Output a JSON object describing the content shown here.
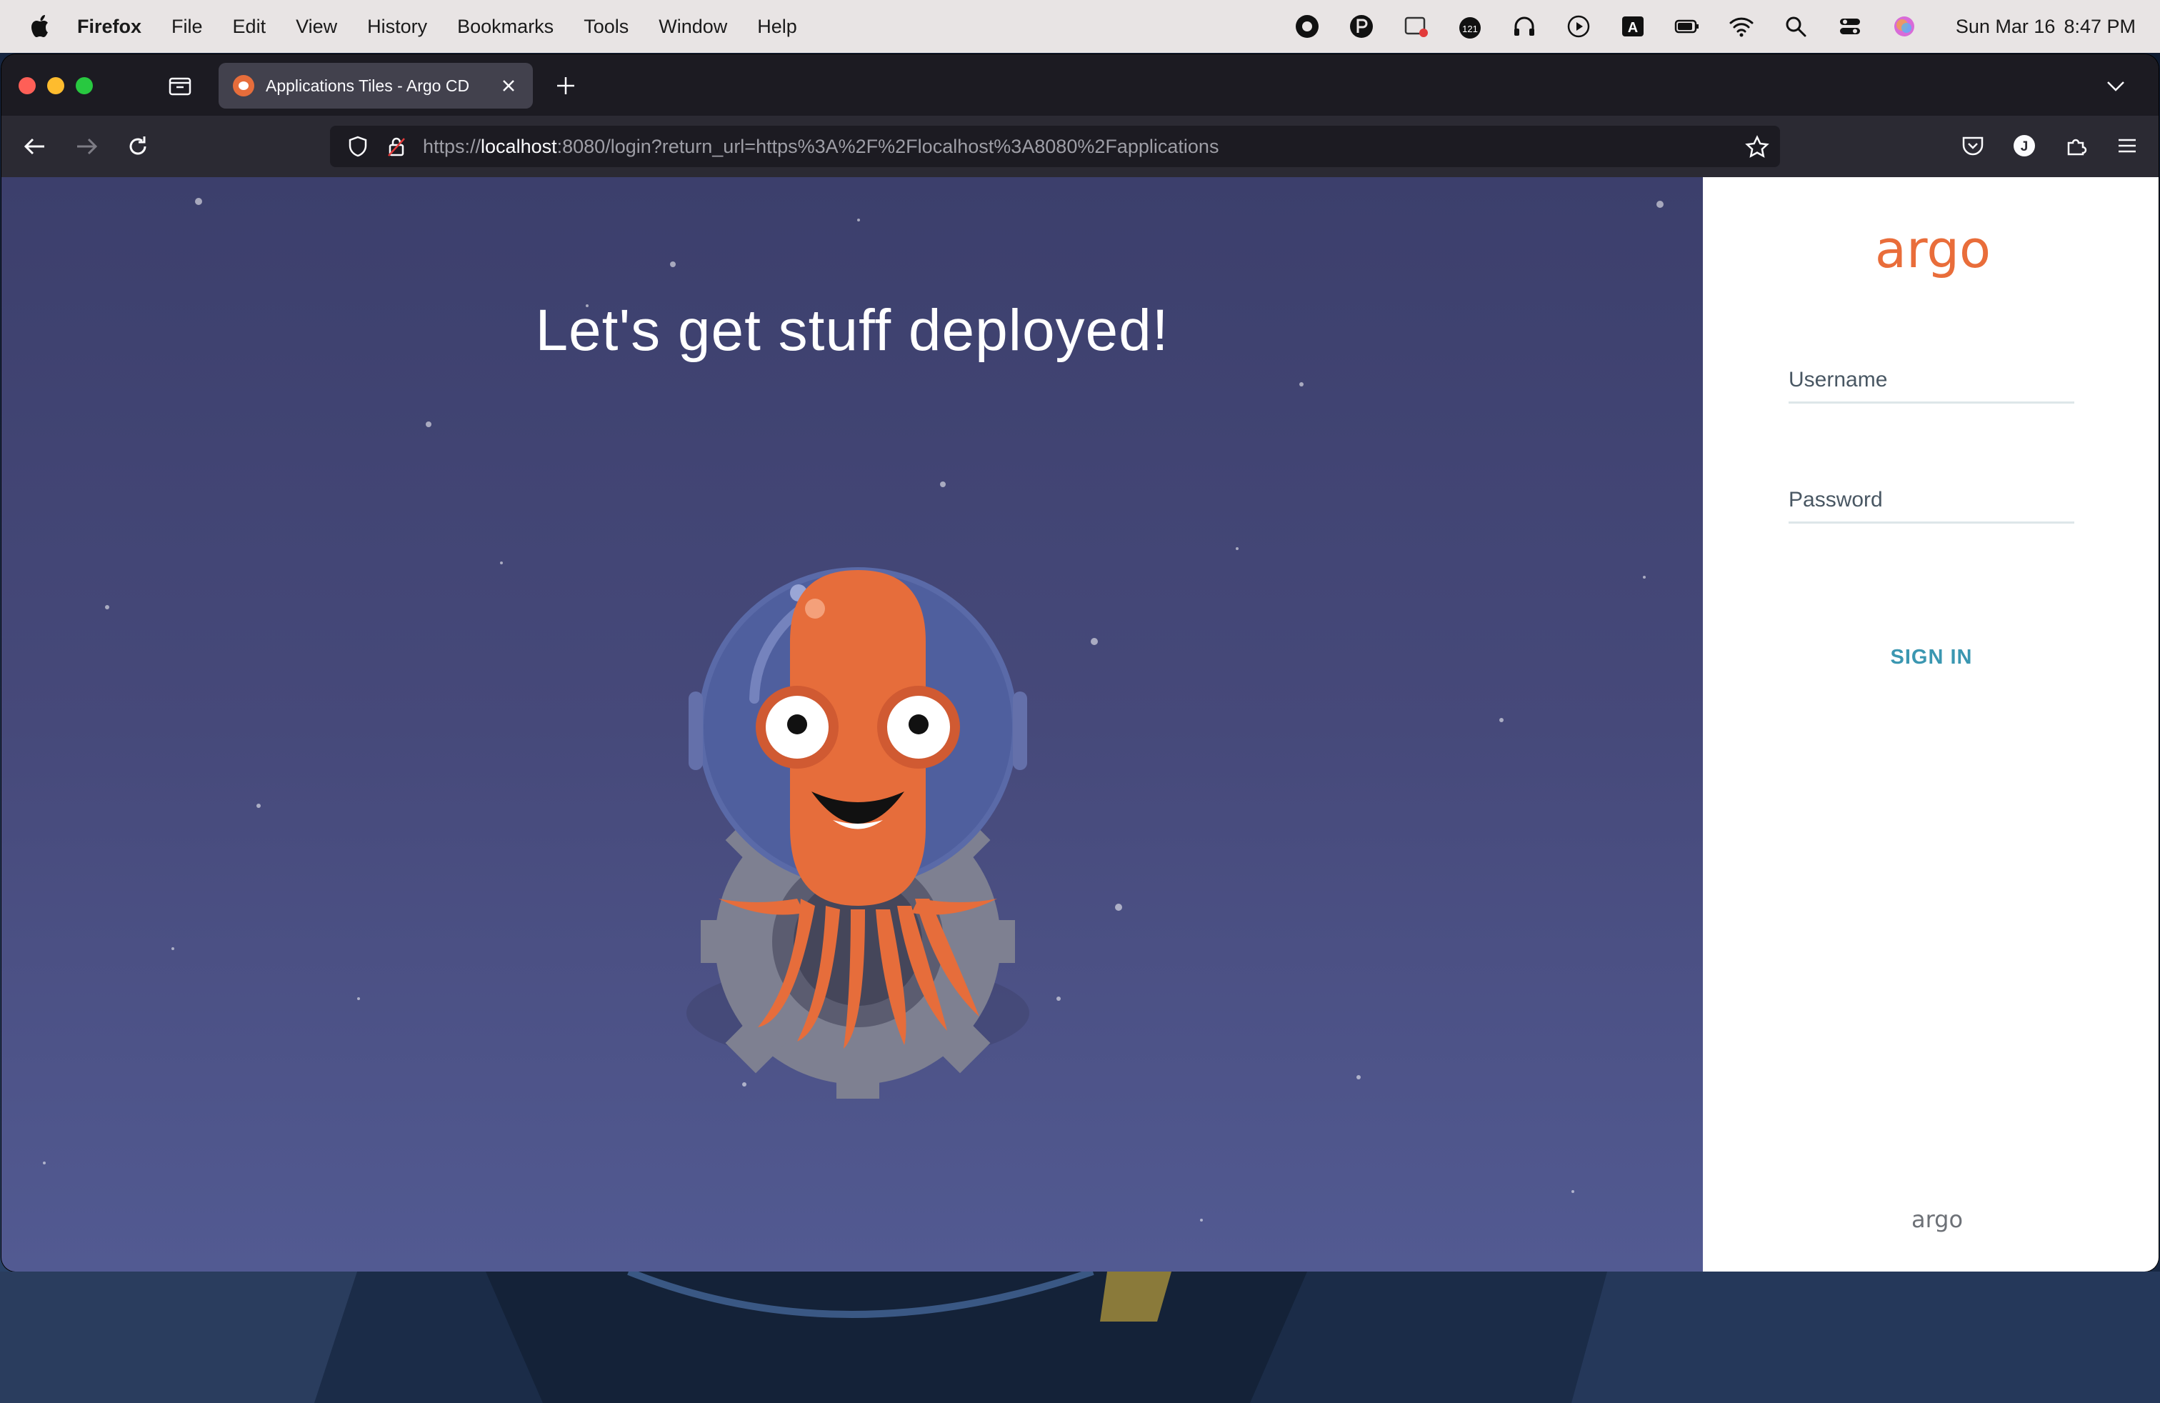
{
  "menubar": {
    "app": "Firefox",
    "items": [
      "File",
      "Edit",
      "View",
      "History",
      "Bookmarks",
      "Tools",
      "Window",
      "Help"
    ],
    "status_badge": "121",
    "status_letter": "A",
    "date": "Sun Mar 16",
    "time": "8:47 PM"
  },
  "browser": {
    "tab_title": "Applications Tiles - Argo CD",
    "url_scheme": "https://",
    "url_host": "localhost",
    "url_rest": ":8080/login?return_url=https%3A%2F%2Flocalhost%3A8080%2Fapplications",
    "account_initial": "J"
  },
  "hero": {
    "title": "Let's get stuff deployed!"
  },
  "login": {
    "logo_text": "argo",
    "username_placeholder": "Username",
    "password_placeholder": "Password",
    "sign_in_label": "SIGN IN",
    "footer_logo_text": "argo"
  },
  "colors": {
    "argo_orange": "#e96d3a",
    "sign_in_teal": "#3b97b1",
    "hero_top": "#3c3f6c",
    "hero_bottom": "#525a92"
  }
}
